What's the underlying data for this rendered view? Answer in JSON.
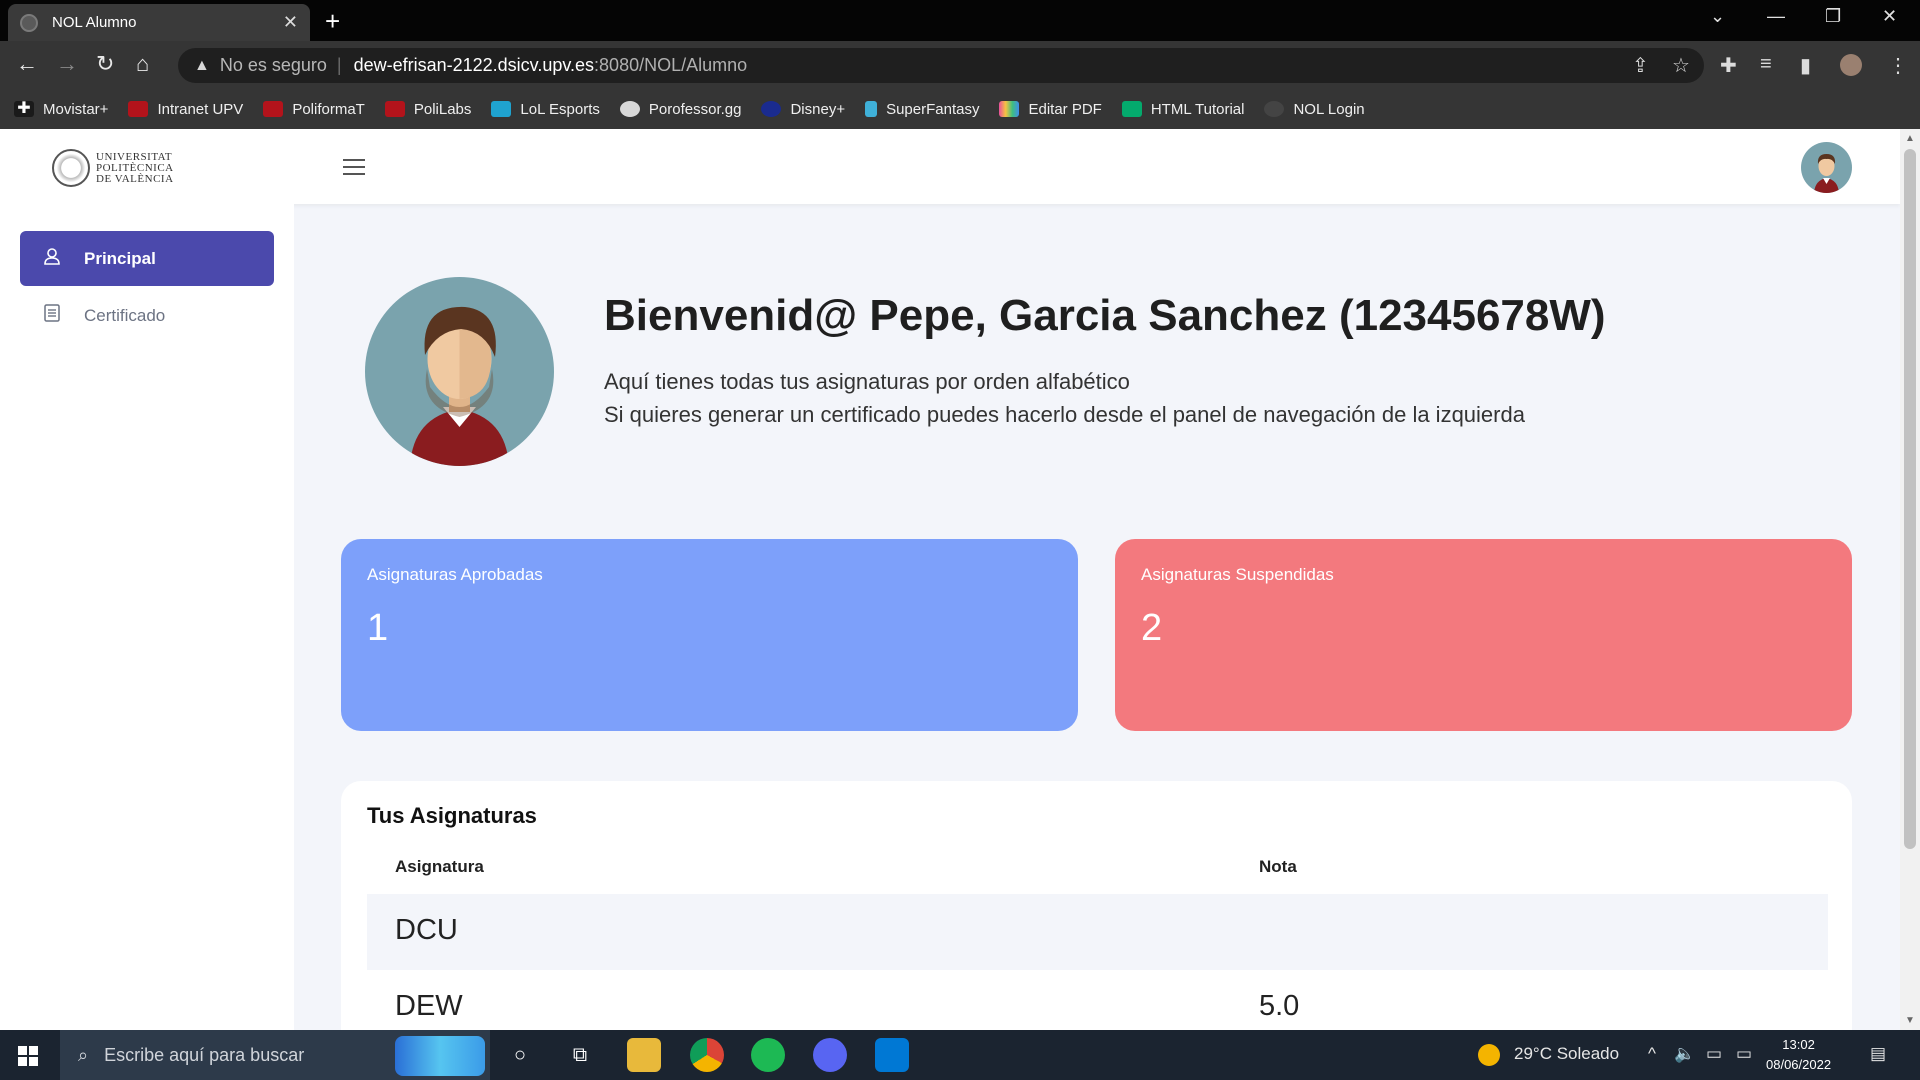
{
  "browser": {
    "tab_title": "NOL Alumno",
    "tab_close": "✕",
    "new_tab": "+",
    "not_secure": "No es seguro",
    "url_host": "dew-efrisan-2122.dsicv.upv.es",
    "url_path": ":8080/NOL/Alumno"
  },
  "bookmarks": [
    {
      "label": "Movistar+",
      "color": "#1a1a1a"
    },
    {
      "label": "Intranet UPV",
      "color": "#b3131b"
    },
    {
      "label": "PoliformaT",
      "color": "#b3131b"
    },
    {
      "label": "PoliLabs",
      "color": "#b3131b"
    },
    {
      "label": "LoL Esports",
      "color": "#1fa3d0"
    },
    {
      "label": "Porofessor.gg",
      "color": "#d8d8d8"
    },
    {
      "label": "Disney+",
      "color": "#1a2b8f"
    },
    {
      "label": "SuperFantasy",
      "color": "#3fb0d8"
    },
    {
      "label": "Editar PDF",
      "color": "#e94f9c"
    },
    {
      "label": "HTML Tutorial",
      "color": "#04aa6d"
    },
    {
      "label": "NOL Login",
      "color": "#444444"
    }
  ],
  "logo": {
    "line1": "UNIVERSITAT",
    "line2": "POLITÈCNICA",
    "line3": "DE VALÈNCIA"
  },
  "sidebar": {
    "items": [
      {
        "label": "Principal",
        "icon": "user-icon",
        "active": true
      },
      {
        "label": "Certificado",
        "icon": "document-icon",
        "active": false
      }
    ]
  },
  "main": {
    "title": "Bienvenid@ Pepe, Garcia Sanchez (12345678W)",
    "line1": "Aquí tienes todas tus asignaturas por orden alfabético",
    "line2": "Si quieres generar un certificado puedes hacerlo desde el panel de navegación de la izquierda",
    "cards": [
      {
        "label": "Asignaturas Aprobadas",
        "value": "1",
        "color": "#7da0fa"
      },
      {
        "label": "Asignaturas Suspendidas",
        "value": "2",
        "color": "#f3797e"
      }
    ],
    "table": {
      "title": "Tus Asignaturas",
      "columns": [
        "Asignatura",
        "Nota"
      ],
      "rows": [
        {
          "subject": "DCU",
          "grade": ""
        },
        {
          "subject": "DEW",
          "grade": "5.0"
        }
      ]
    }
  },
  "taskbar": {
    "search_placeholder": "Escribe aquí para buscar",
    "weather": "29°C  Soleado",
    "time": "13:02",
    "date": "08/06/2022"
  }
}
